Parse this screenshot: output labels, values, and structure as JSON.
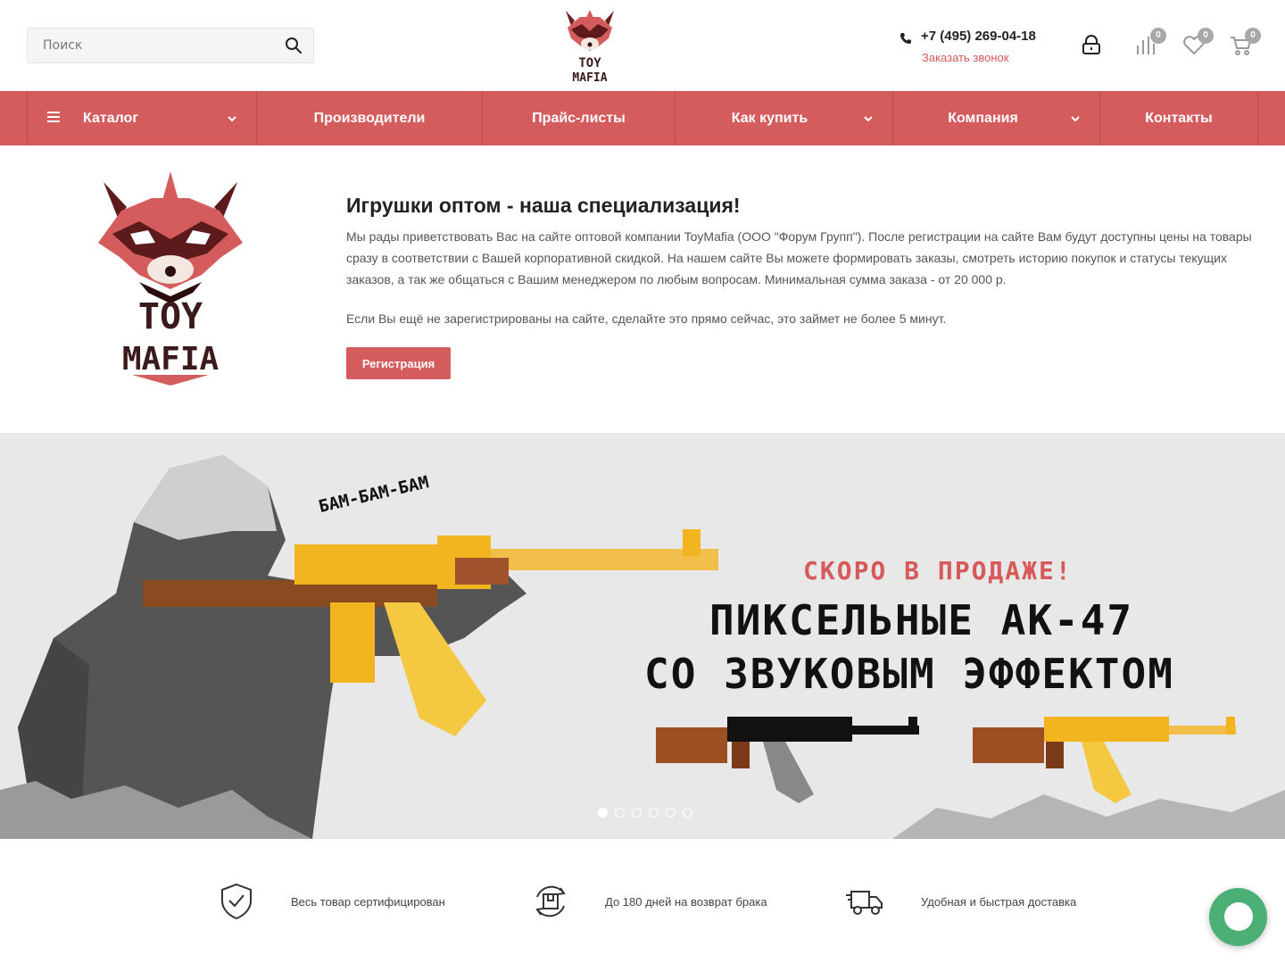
{
  "header": {
    "search_placeholder": "Поиск",
    "phone": "+7 (495) 269-04-18",
    "callback": "Заказать звонок",
    "compare_count": "0",
    "wishlist_count": "0",
    "cart_count": "0"
  },
  "nav": {
    "items": [
      {
        "label": "Каталог",
        "dropdown": true
      },
      {
        "label": "Производители",
        "dropdown": false
      },
      {
        "label": "Прайс-листы",
        "dropdown": false
      },
      {
        "label": "Как купить",
        "dropdown": true
      },
      {
        "label": "Компания",
        "dropdown": true
      },
      {
        "label": "Контакты",
        "dropdown": false
      }
    ]
  },
  "intro": {
    "logo_text_1": "TOY",
    "logo_text_2": "MAFIA",
    "title": "Игрушки оптом - наша специализация!",
    "paragraph1": "Мы рады приветствовать Вас на сайте оптовой компании ToyMafia (ООО \"Форум Групп\"). После регистрации на сайте Вам будут доступны цены на товары сразу в соответствии с Вашей корпоративной скидкой. На нашем сайте Вы можете формировать заказы, смотреть историю покупок и статусы текущих заказов, а так же общаться с Вашим менеджером по любым вопросам. Минимальная сумма заказа - от 20 000 р.",
    "paragraph2": "Если Вы ещё не зарегистрированы на сайте, сделайте это прямо сейчас, это займет не более 5 минут.",
    "register_button": "Регистрация"
  },
  "banner": {
    "sound_text": "БАМ-БАМ-БАМ",
    "tag": "СКОРО В ПРОДАЖЕ!",
    "line1": "ПИКСЕЛЬНЫЕ АК-47",
    "line2": "СО ЗВУКОВЫМ ЭФФЕКТОМ",
    "slides_total": 6,
    "active_slide": 1
  },
  "features": [
    {
      "icon": "shield-check-icon",
      "text": "Весь товар сертифицирован"
    },
    {
      "icon": "return-box-icon",
      "text": "До 180 дней на возврат брака"
    },
    {
      "icon": "delivery-truck-icon",
      "text": "Удобная и быстрая доставка"
    }
  ],
  "colors": {
    "brand_red": "#d45c5c",
    "chat_green": "#4caf76",
    "badge_gray": "#a8a8a8"
  }
}
